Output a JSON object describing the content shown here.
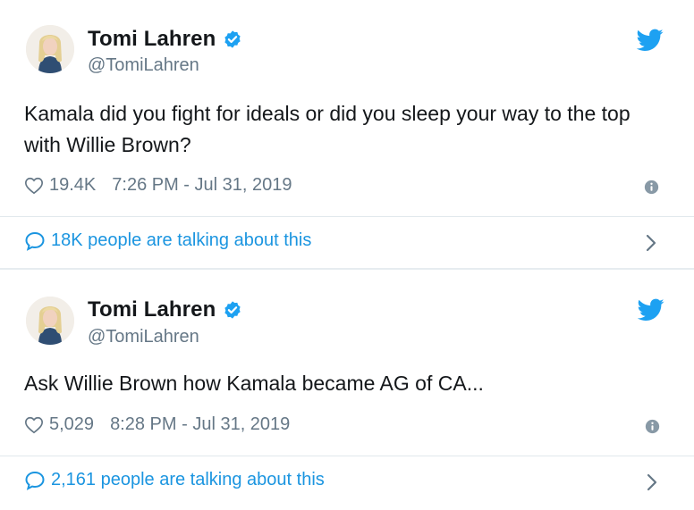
{
  "tweets": [
    {
      "name": "Tomi Lahren",
      "handle": "@TomiLahren",
      "text": "Kamala did you fight for ideals or did you sleep your way to the top with Willie Brown?",
      "likes": "19.4K",
      "timestamp": "7:26 PM - Jul 31, 2019",
      "talking": "18K people are talking about this"
    },
    {
      "name": "Tomi Lahren",
      "handle": "@TomiLahren",
      "text": "Ask Willie Brown how Kamala became AG of CA...",
      "likes": "5,029",
      "timestamp": "8:28 PM - Jul 31, 2019",
      "talking": "2,161 people are talking about this"
    }
  ],
  "icons": {
    "verified": "verified-badge-icon",
    "bird": "twitter-bird-icon",
    "like": "heart-icon",
    "info": "info-icon",
    "reply": "speech-bubble-icon",
    "chevron": "chevron-right-icon"
  },
  "colors": {
    "brand_blue": "#1da1f2",
    "link_blue": "#1b95e0",
    "muted": "#657786",
    "text": "#14171a",
    "divider": "#e1e8ed"
  }
}
